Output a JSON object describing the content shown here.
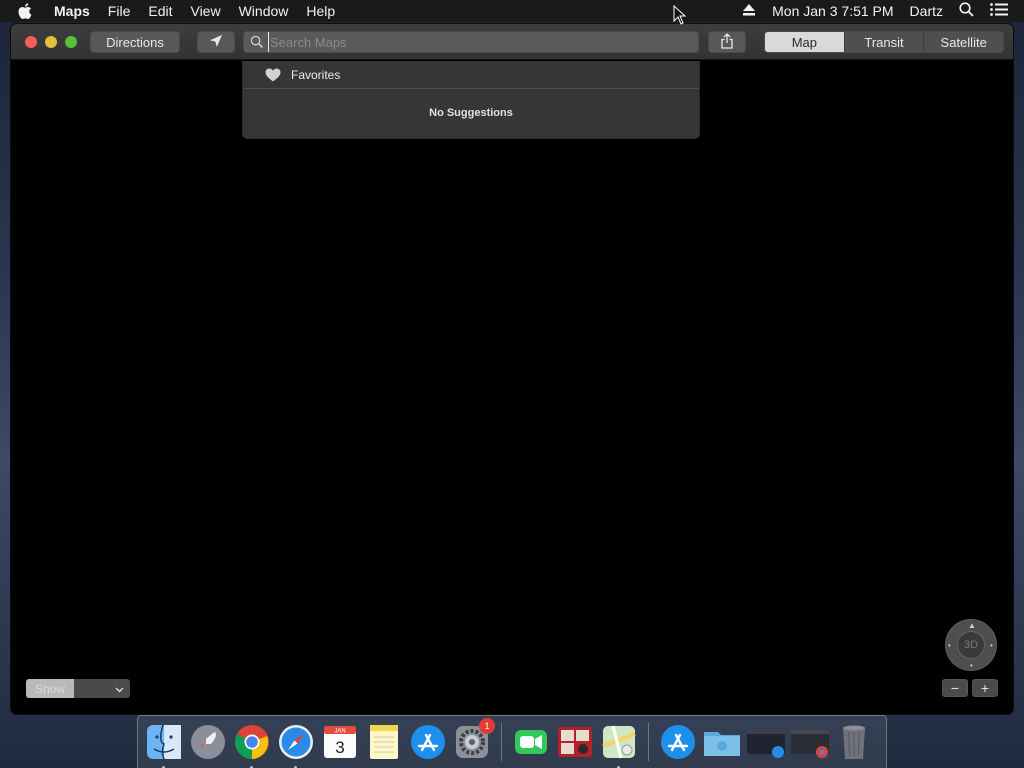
{
  "menubar": {
    "app_name": "Maps",
    "menus": [
      "File",
      "Edit",
      "View",
      "Window",
      "Help"
    ],
    "clock": "Mon Jan 3  7:51 PM",
    "user": "Dartz"
  },
  "toolbar": {
    "directions_label": "Directions",
    "search_placeholder": "Search Maps",
    "search_value": "",
    "map_modes": [
      "Map",
      "Transit",
      "Satellite"
    ],
    "selected_mode": "Map"
  },
  "suggestions": {
    "favorites_label": "Favorites",
    "empty_message": "No Suggestions"
  },
  "map_controls": {
    "show_label": "Show",
    "compass_label": "3D",
    "zoom_out": "−",
    "zoom_in": "+"
  },
  "dock": {
    "apps": [
      {
        "name": "Finder",
        "icon": "finder-icon",
        "running": true
      },
      {
        "name": "Launchpad",
        "icon": "launchpad-icon",
        "running": false
      },
      {
        "name": "Google Chrome",
        "icon": "chrome-icon",
        "running": true
      },
      {
        "name": "Safari",
        "icon": "safari-icon",
        "running": true
      },
      {
        "name": "Calendar",
        "icon": "calendar-icon",
        "running": false,
        "month": "JAN",
        "day": "3"
      },
      {
        "name": "Notes",
        "icon": "notes-icon",
        "running": false
      },
      {
        "name": "App Store",
        "icon": "app-store-icon",
        "running": false
      },
      {
        "name": "System Preferences",
        "icon": "system-preferences-icon",
        "running": false,
        "badge": "1"
      },
      {
        "name": "FaceTime",
        "icon": "facetime-icon",
        "running": false
      },
      {
        "name": "Photo Booth",
        "icon": "photo-booth-icon",
        "running": false
      },
      {
        "name": "Maps",
        "icon": "maps-icon",
        "running": true
      },
      {
        "name": "App Store Folder",
        "icon": "app-store-folder-icon",
        "running": false
      },
      {
        "name": "Folder",
        "icon": "folder-icon",
        "running": false
      },
      {
        "name": "Safari Window",
        "icon": "safari-window-icon",
        "running": false
      },
      {
        "name": "Chrome Window",
        "icon": "chrome-window-icon",
        "running": false
      },
      {
        "name": "Trash",
        "icon": "trash-icon",
        "running": false
      }
    ]
  },
  "colors": {
    "close": "#fc5b57",
    "minimize": "#e5bf3c",
    "maximize": "#57c038",
    "badge": "#e33a32"
  }
}
